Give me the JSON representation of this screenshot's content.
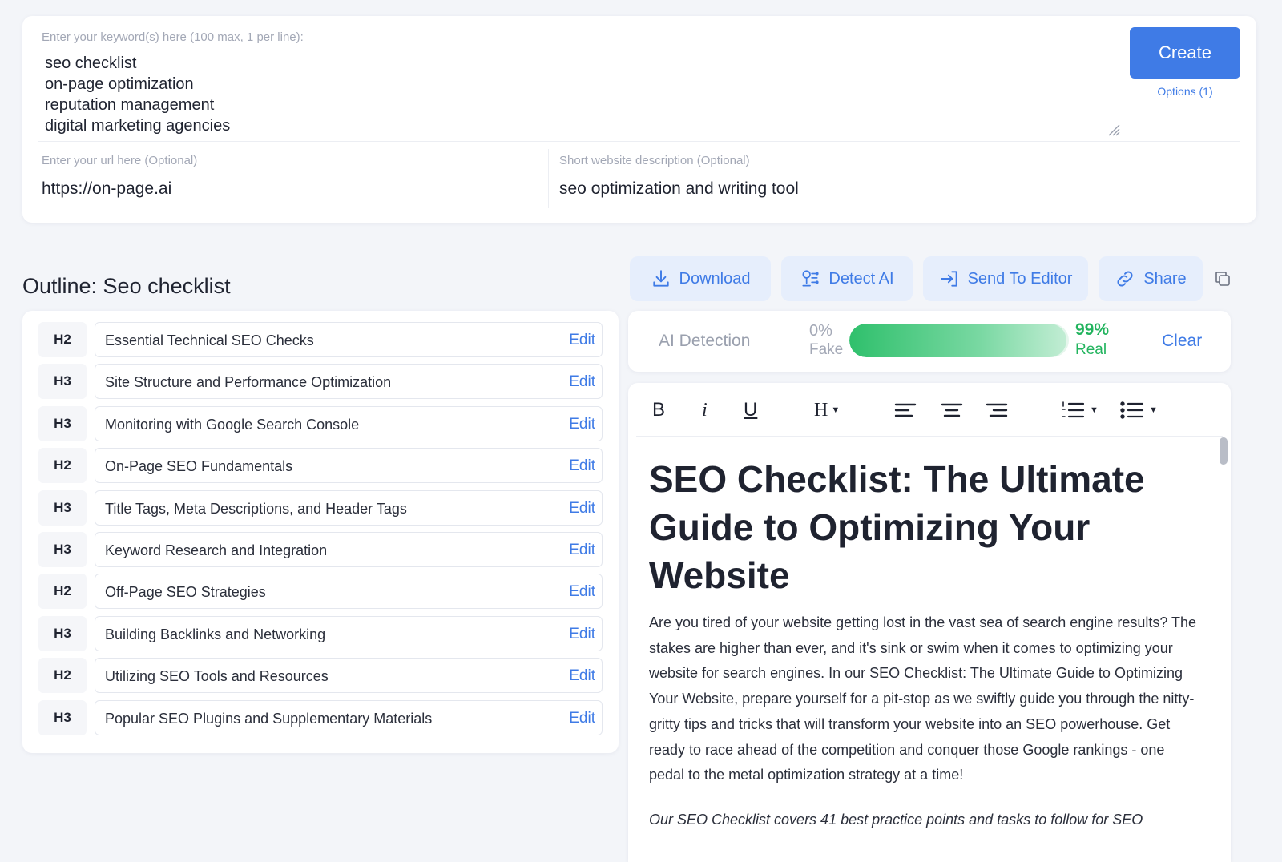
{
  "keywords": {
    "label": "Enter your keyword(s) here (100 max, 1 per line):",
    "value": "seo checklist\non-page optimization\nreputation management\ndigital marketing agencies"
  },
  "create_button": "Create",
  "options_link": "Options (1)",
  "url": {
    "label": "Enter your url here (Optional)",
    "value": "https://on-page.ai"
  },
  "description": {
    "label": "Short website description (Optional)",
    "value": "seo optimization and writing tool"
  },
  "outline": {
    "title": "Outline: Seo checklist",
    "edit_label": "Edit",
    "rows": [
      {
        "tag": "H2",
        "text": "Essential Technical SEO Checks"
      },
      {
        "tag": "H3",
        "text": "Site Structure and Performance Optimization"
      },
      {
        "tag": "H3",
        "text": "Monitoring with Google Search Console"
      },
      {
        "tag": "H2",
        "text": "On-Page SEO Fundamentals"
      },
      {
        "tag": "H3",
        "text": "Title Tags, Meta Descriptions, and Header Tags"
      },
      {
        "tag": "H3",
        "text": "Keyword Research and Integration"
      },
      {
        "tag": "H2",
        "text": "Off-Page SEO Strategies"
      },
      {
        "tag": "H3",
        "text": "Building Backlinks and Networking"
      },
      {
        "tag": "H2",
        "text": "Utilizing SEO Tools and Resources"
      },
      {
        "tag": "H3",
        "text": "Popular SEO Plugins and Supplementary Materials"
      }
    ]
  },
  "actions": {
    "download": "Download",
    "detect_ai": "Detect AI",
    "send_to_editor": "Send To Editor",
    "share": "Share"
  },
  "ai_detection": {
    "label": "AI Detection",
    "fake_percent": "0%",
    "fake_label": "Fake",
    "real_percent": "99%",
    "real_label": "Real",
    "real_fraction": 0.99,
    "clear_label": "Clear"
  },
  "editor": {
    "toolbar": {
      "bold": "B",
      "italic": "i",
      "underline": "U",
      "heading": "H"
    },
    "title": "SEO Checklist: The Ultimate Guide to Optimizing Your Website",
    "intro": "Are you tired of your website getting lost in the vast sea of search engine results? The stakes are higher than ever, and it's sink or swim when it comes to optimizing your website for search engines. In our SEO Checklist: The Ultimate Guide to Optimizing Your Website, prepare yourself for a pit-stop as we swiftly guide you through the nitty-gritty tips and tricks that will transform your website into an SEO powerhouse. Get ready to race ahead of the competition and conquer those Google rankings - one pedal to the metal optimization strategy at a time!",
    "italic_line": "Our SEO Checklist covers 41 best practice points and tasks to follow for SEO"
  },
  "colors": {
    "accent": "#3f7be6",
    "real_green": "#22b45e",
    "background": "#f3f5f9"
  }
}
